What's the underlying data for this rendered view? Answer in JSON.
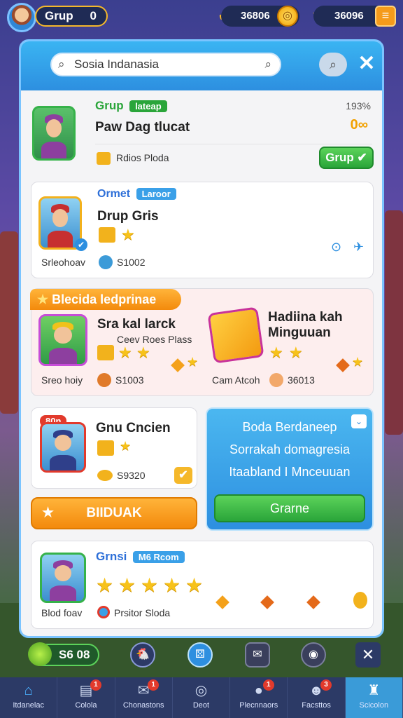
{
  "hud": {
    "player_name": "Grup",
    "level": "0",
    "resource1": "36806",
    "resource2": "36096"
  },
  "panel": {
    "search_placeholder": "Sosia Indanasia"
  },
  "cards": {
    "c1": {
      "tag": "Grup",
      "badge": "lateap",
      "title": "Paw Dag tlucat",
      "sub": "Rdios Ploda",
      "percent": "193%",
      "count": "0",
      "button": "Grup"
    },
    "c2": {
      "tag": "Ormet",
      "badge": "Laroor",
      "title": "Drup Gris",
      "name": "Srleohoav",
      "value": "S1002"
    },
    "c3": {
      "banner": "Blecida ledprinae",
      "title": "Sra kal larck",
      "subtitle": "Ceev Roes Plass",
      "name": "Sreo hoiy",
      "value": "S1003",
      "right_title": "Hadiina kah Minguuan",
      "right_name": "Cam Atcoh",
      "right_value": "36013"
    },
    "c4": {
      "badge": "80n",
      "title": "Gnu Cncien",
      "value": "S9320"
    },
    "c4b": {
      "button": "BIIDUAK"
    },
    "c5": {
      "title": "Boda Berdaneep",
      "line2": "Sorrakah domagresia",
      "line3": "Itaabland I Mnceuuan",
      "button": "Grarne"
    },
    "c6": {
      "tag": "Grnsi",
      "badge": "M6 Rcom",
      "name": "Blod foav",
      "value": "Prsitor Sloda"
    }
  },
  "bottom_counter": "S6 08",
  "nav": [
    {
      "label": "Itdanelac",
      "icon": "home-icon"
    },
    {
      "label": "Colola",
      "icon": "shop-icon",
      "badge": "1"
    },
    {
      "label": "Chonastons",
      "icon": "mail-icon",
      "badge": "1"
    },
    {
      "label": "Deot",
      "icon": "compass-icon"
    },
    {
      "label": "Plecnnaors",
      "icon": "chat-icon",
      "badge": "1"
    },
    {
      "label": "Facsttos",
      "icon": "friends-icon",
      "badge": "3"
    },
    {
      "label": "Scicolon",
      "icon": "tower-icon"
    }
  ],
  "colors": {
    "accent": "#2d8fe0",
    "green": "#2aa53a",
    "orange": "#f38a0c"
  }
}
